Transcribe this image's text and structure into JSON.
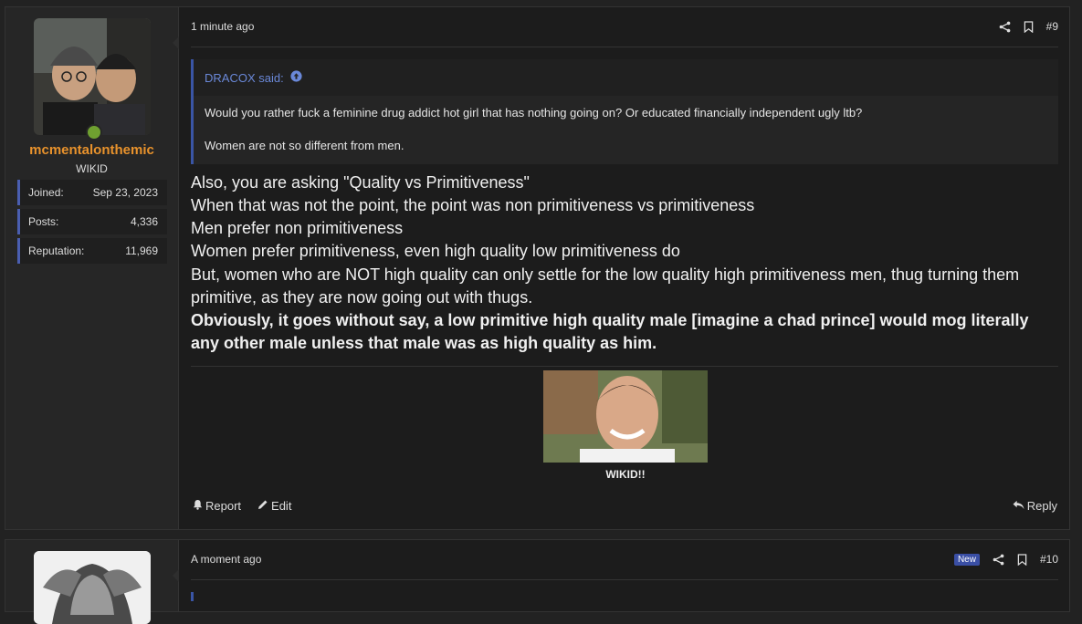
{
  "post1": {
    "username": "mcmentalonthemic",
    "user_title": "WIKID",
    "stats": [
      {
        "key": "Joined:",
        "value": "Sep 23, 2023"
      },
      {
        "key": "Posts:",
        "value": "4,336"
      },
      {
        "key": "Reputation:",
        "value": "11,969"
      }
    ],
    "time": "1 minute ago",
    "post_number": "#9",
    "quote": {
      "author": "DRACOX said:",
      "lines": [
        "Would you rather fuck a feminine drug addict hot girl that has nothing going on? Or educated financially independent ugly ltb?",
        "Women are not so different from men."
      ]
    },
    "body": [
      "Also, you are asking \"Quality vs Primitiveness\"",
      "When that was not the point, the point was non primitiveness vs primitiveness",
      "Men prefer non primitiveness",
      "Women prefer primitiveness, even high quality low primitiveness do",
      "But, women who are NOT high quality can only settle for the low quality high primitiveness men, thug turning them",
      "primitive, as they are now going out with thugs."
    ],
    "bold_body": [
      "Obviously, it goes without say, a low primitive high quality male [imagine a chad prince] would mog literally",
      "any other male unless that male was as high quality as him."
    ],
    "image_caption": "WIKID!!",
    "actions": {
      "report": "Report",
      "edit": "Edit",
      "reply": "Reply"
    }
  },
  "post2": {
    "time": "A moment ago",
    "badge": "New",
    "post_number": "#10"
  },
  "colors": {
    "username": "#e8922c",
    "accent_blue": "#3a55a5",
    "online": "#6fa030"
  }
}
